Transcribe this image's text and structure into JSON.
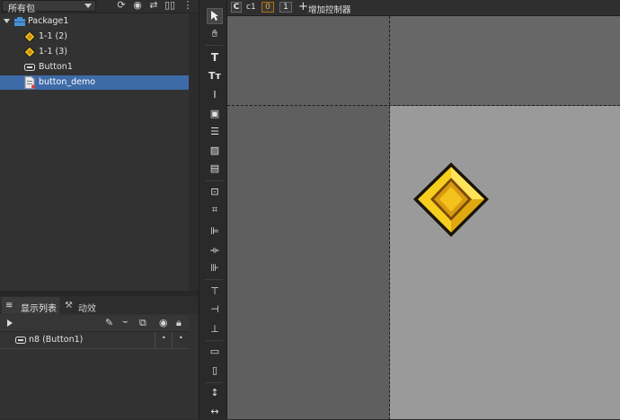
{
  "left_panel": {
    "package_select": "所有包",
    "tree": {
      "root": "Package1",
      "items": [
        "1-1 (2)",
        "1-1 (3)",
        "Button1",
        "button_demo"
      ]
    }
  },
  "bottom_tabs": {
    "display_list": "显示列表",
    "animation": "动效"
  },
  "display_list": {
    "items": [
      {
        "label": "n8 (Button1)",
        "c1": "•",
        "c2": "•"
      }
    ]
  },
  "controller_bar": {
    "c_label": "C",
    "controller_name": "c1",
    "page0": "0",
    "page1": "1",
    "add_controller": "增加控制器"
  },
  "colors": {
    "selection": "#3e6aa8",
    "canvas": "#5c5c5c",
    "stage": "#9a9a9a",
    "diamond": "#f2c21a"
  },
  "icons": [
    "refresh-icon",
    "target-icon",
    "swap-icon",
    "columns-icon",
    "more-icon",
    "select-arrow-icon",
    "hand-icon",
    "text-icon",
    "rich-text-icon",
    "input-text-icon",
    "image-icon",
    "list-icon",
    "loader-icon",
    "graph-icon",
    "component-icon",
    "relation-icon",
    "align-left-icon",
    "align-center-icon",
    "align-right-icon",
    "align-top-icon",
    "align-middle-icon",
    "align-bottom-icon",
    "same-width-icon",
    "same-height-icon",
    "distribute-h-icon",
    "distribute-v-icon"
  ]
}
